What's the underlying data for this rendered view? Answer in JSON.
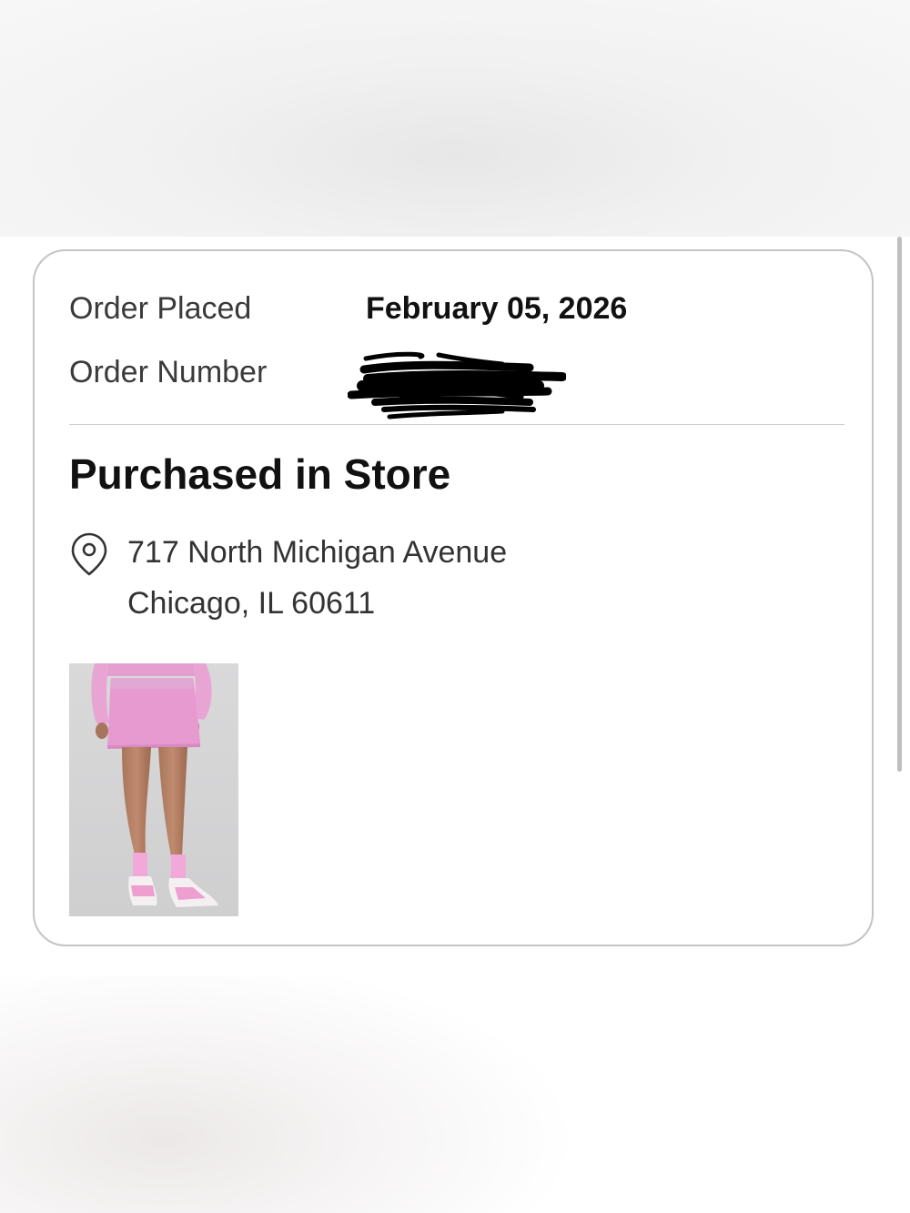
{
  "order": {
    "placed_label": "Order Placed",
    "placed_value": "February 05, 2026",
    "number_label": "Order Number"
  },
  "store": {
    "title": "Purchased in Store",
    "address_line1": "717 North Michigan Avenue",
    "address_line2": "Chicago, IL 60611"
  },
  "product": {
    "image": "pink-skirt-product-photo",
    "accent": "#e79ad0"
  },
  "colors": {
    "text_primary": "#111111",
    "text_secondary": "#3a3a3a",
    "card_border": "#c4c4c4",
    "redaction": "#000000"
  },
  "icons": [
    "location-pin-icon"
  ]
}
